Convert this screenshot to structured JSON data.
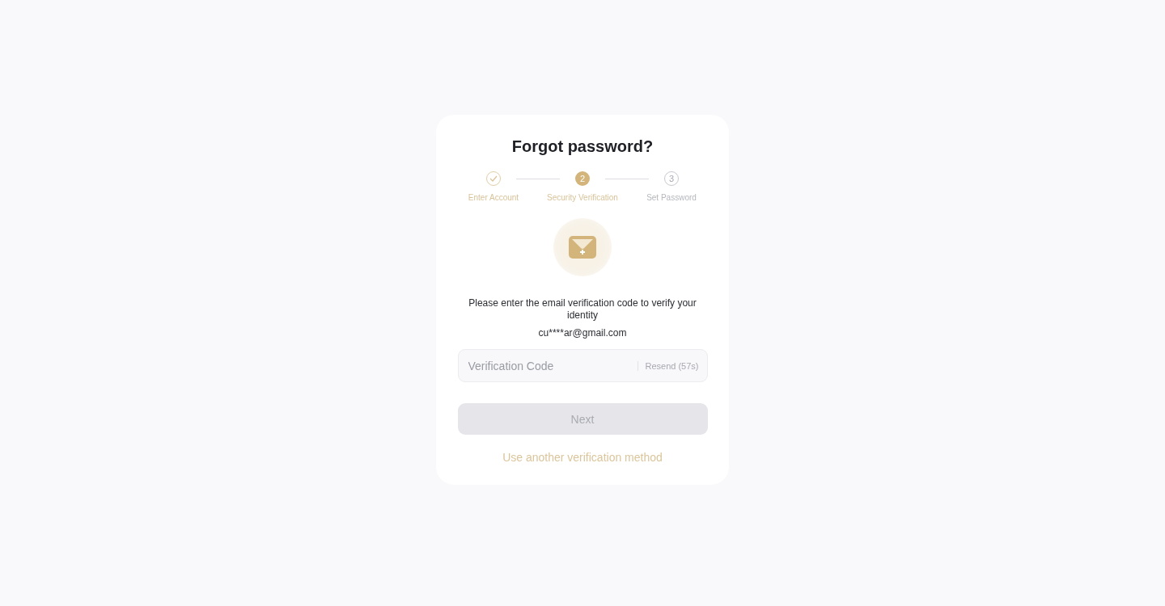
{
  "title": "Forgot password?",
  "steps": [
    {
      "label": "Enter Account",
      "kind": "done"
    },
    {
      "number": "2",
      "label": "Security Verification",
      "kind": "current"
    },
    {
      "number": "3",
      "label": "Set Password",
      "kind": "pending"
    }
  ],
  "message": "Please enter the email verification code to verify your identity",
  "email": "cu****ar@gmail.com",
  "code_field": {
    "placeholder": "Verification Code",
    "resend": "Resend (57s)"
  },
  "next_button": {
    "label": "Next",
    "disabled": true
  },
  "alt_link": "Use another verification method"
}
